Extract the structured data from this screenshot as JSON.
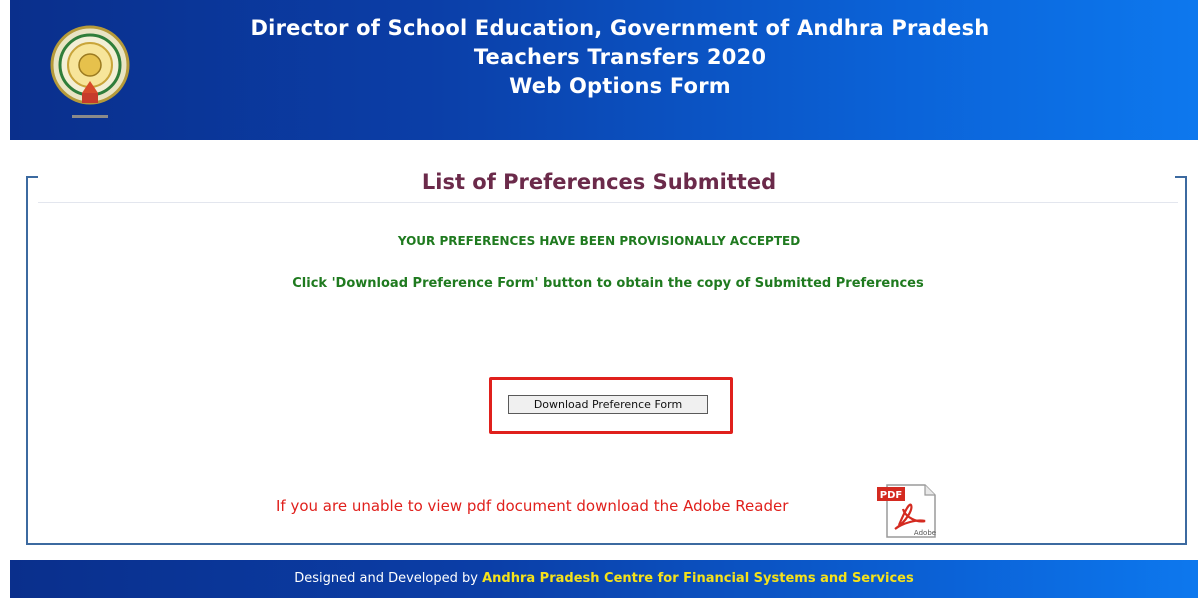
{
  "header": {
    "emblem_name": "andhra-pradesh-emblem-icon",
    "line1": "Director of School Education, Government of Andhra Pradesh",
    "line2": "Teachers Transfers 2020",
    "line3": "Web Options Form",
    "gradient_start": "#0a2f8c",
    "gradient_end": "#0d78ee"
  },
  "panel": {
    "title": "List of Preferences Submitted",
    "status_message": "YOUR PREFERENCES HAVE BEEN PROVISIONALLY ACCEPTED",
    "instruction": "Click 'Download Preference Form' button to obtain the copy of Submitted Preferences",
    "download_button_label": "Download Preference Form",
    "adobe_message": "If you are unable to view pdf document download the Adobe Reader",
    "pdf_icon_text": "PDF",
    "pdf_icon_brand": "Adobe",
    "highlight_color": "#e0201c",
    "message_color": "#1f7a1f",
    "title_color": "#6b2a4a"
  },
  "footer": {
    "prefix": "Designed and Developed by",
    "organization": "Andhra Pradesh Centre for Financial Systems and Services"
  }
}
